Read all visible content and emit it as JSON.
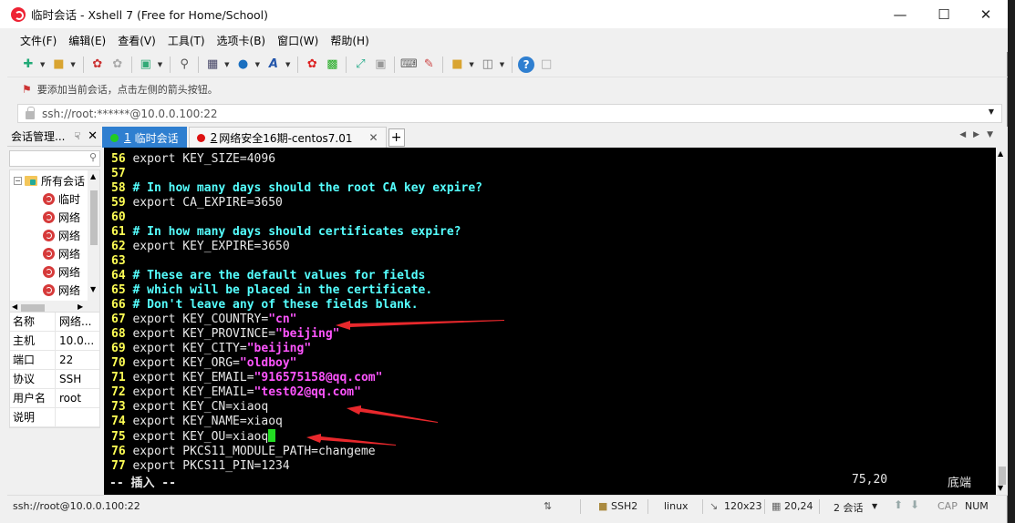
{
  "window": {
    "title": "临时会话 - Xshell 7 (Free for Home/School)"
  },
  "menu": [
    "文件(F)",
    "编辑(E)",
    "查看(V)",
    "工具(T)",
    "选项卡(B)",
    "窗口(W)",
    "帮助(H)"
  ],
  "hint": "要添加当前会话，点击左侧的箭头按钮。",
  "address": "ssh://root:******@10.0.0.100:22",
  "session_manager": {
    "title": "会话管理...",
    "tree": {
      "root": "所有会话",
      "items": [
        "临时",
        "网络",
        "网络",
        "网络",
        "网络",
        "网络"
      ]
    },
    "props": [
      {
        "k": "名称",
        "v": "网络..."
      },
      {
        "k": "主机",
        "v": "10.0..."
      },
      {
        "k": "端口",
        "v": "22"
      },
      {
        "k": "协议",
        "v": "SSH"
      },
      {
        "k": "用户名",
        "v": "root"
      },
      {
        "k": "说明",
        "v": ""
      }
    ]
  },
  "tabs": [
    {
      "num": "1",
      "label": "临时会话",
      "dot": "#22cc22",
      "active": true
    },
    {
      "num": "2",
      "label": "网络安全16期-centos7.01",
      "dot": "#dd1111",
      "active": false
    }
  ],
  "terminal": {
    "lines": [
      {
        "n": "56",
        "parts": [
          [
            "tx",
            "export KEY_SIZE=4096"
          ]
        ]
      },
      {
        "n": "57",
        "parts": []
      },
      {
        "n": "58",
        "parts": [
          [
            "cm",
            "# In how many days should the root CA key expire?"
          ]
        ]
      },
      {
        "n": "59",
        "parts": [
          [
            "tx",
            "export CA_EXPIRE=3650"
          ]
        ]
      },
      {
        "n": "60",
        "parts": []
      },
      {
        "n": "61",
        "parts": [
          [
            "cm",
            "# In how many days should certificates expire?"
          ]
        ]
      },
      {
        "n": "62",
        "parts": [
          [
            "tx",
            "export KEY_EXPIRE=3650"
          ]
        ]
      },
      {
        "n": "63",
        "parts": []
      },
      {
        "n": "64",
        "parts": [
          [
            "cm",
            "# These are the default values for fields"
          ]
        ]
      },
      {
        "n": "65",
        "parts": [
          [
            "cm",
            "# which will be placed in the certificate."
          ]
        ]
      },
      {
        "n": "66",
        "parts": [
          [
            "cm",
            "# Don't leave any of these fields blank."
          ]
        ]
      },
      {
        "n": "67",
        "parts": [
          [
            "tx",
            "export KEY_COUNTRY="
          ],
          [
            "st",
            "\"cn\""
          ]
        ]
      },
      {
        "n": "68",
        "parts": [
          [
            "tx",
            "export KEY_PROVINCE="
          ],
          [
            "st",
            "\"beijing\""
          ]
        ]
      },
      {
        "n": "69",
        "parts": [
          [
            "tx",
            "export KEY_CITY="
          ],
          [
            "st",
            "\"beijing\""
          ]
        ]
      },
      {
        "n": "70",
        "parts": [
          [
            "tx",
            "export KEY_ORG="
          ],
          [
            "st",
            "\"oldboy\""
          ]
        ]
      },
      {
        "n": "71",
        "parts": [
          [
            "tx",
            "export KEY_EMAIL="
          ],
          [
            "st",
            "\"916575158@qq.com\""
          ]
        ]
      },
      {
        "n": "72",
        "parts": [
          [
            "tx",
            "export KEY_EMAIL="
          ],
          [
            "st",
            "\"test02@qq.com\""
          ]
        ]
      },
      {
        "n": "73",
        "parts": [
          [
            "tx",
            "export KEY_CN=xiaoq"
          ]
        ]
      },
      {
        "n": "74",
        "parts": [
          [
            "tx",
            "export KEY_NAME=xiaoq"
          ]
        ]
      },
      {
        "n": "75",
        "parts": [
          [
            "tx",
            "export KEY_OU=xiaoq"
          ]
        ],
        "cursor": true
      },
      {
        "n": "76",
        "parts": [
          [
            "tx",
            "export PKCS11_MODULE_PATH=changeme"
          ]
        ]
      },
      {
        "n": "77",
        "parts": [
          [
            "tx",
            "export PKCS11_PIN=1234"
          ]
        ]
      }
    ],
    "mode": "-- 插入 --",
    "position": "75,20",
    "scroll_label": "底端"
  },
  "status": {
    "conn": "ssh://root@10.0.0.100:22",
    "protocol": "SSH2",
    "term": "linux",
    "size": "120x23",
    "cursor": "20,24",
    "sessions": "2 会话",
    "cap": "CAP",
    "num": "NUM"
  },
  "colors": {
    "tab_active": "#2f7fd0",
    "annotation_arrow": "#e8282c"
  }
}
